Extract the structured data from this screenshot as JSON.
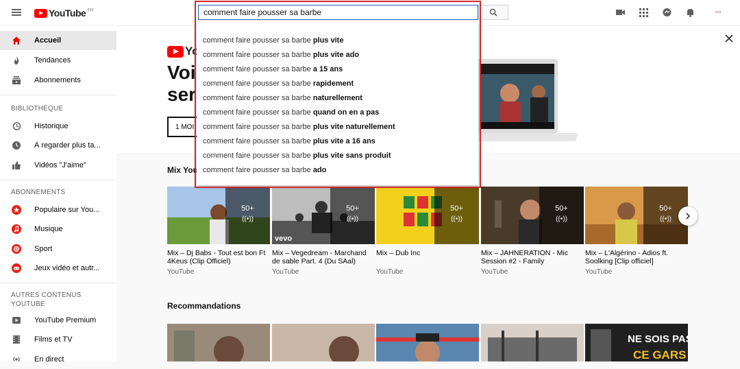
{
  "header": {
    "logo_text": "YouTube",
    "region": "FR",
    "search_value": "comment faire pousser sa barbe",
    "icons": [
      "menu-icon",
      "search-icon",
      "video-camera-icon",
      "apps-grid-icon",
      "messages-icon",
      "bell-icon",
      "account-avatar"
    ]
  },
  "suggestions": [
    {
      "prefix": "comment faire pousser sa barbe ",
      "bold": "plus vite"
    },
    {
      "prefix": "comment faire pousser sa barbe ",
      "bold": "plus vite ado"
    },
    {
      "prefix": "comment faire pousser sa barbe ",
      "bold": "a 15 ans"
    },
    {
      "prefix": "comment faire pousser sa barbe ",
      "bold": "rapidement"
    },
    {
      "prefix": "comment faire pousser sa barbe ",
      "bold": "naturellement"
    },
    {
      "prefix": "comment faire pousser sa barbe ",
      "bold": "quand on en a pas"
    },
    {
      "prefix": "comment faire pousser sa barbe ",
      "bold": "plus vite naturellement"
    },
    {
      "prefix": "comment faire pousser sa barbe ",
      "bold": "plus vite a 16 ans"
    },
    {
      "prefix": "comment faire pousser sa barbe ",
      "bold": "plus vite sans produit"
    },
    {
      "prefix": "comment faire pousser sa barbe ",
      "bold": "ado"
    }
  ],
  "sidebar": {
    "main": [
      {
        "label": "Accueil",
        "icon": "home-icon"
      },
      {
        "label": "Tendances",
        "icon": "flame-icon"
      },
      {
        "label": "Abonnements",
        "icon": "subscriptions-icon"
      }
    ],
    "library_head": "BIBLIOTHÈQUE",
    "library": [
      {
        "label": "Historique",
        "icon": "history-icon"
      },
      {
        "label": "À regarder plus ta...",
        "icon": "clock-icon"
      },
      {
        "label": "Vidéos \"J'aime\"",
        "icon": "thumbs-up-icon"
      }
    ],
    "subs_head": "ABONNEMENTS",
    "subs": [
      {
        "label": "Populaire sur You...",
        "icon": "popular-channel-icon"
      },
      {
        "label": "Musique",
        "icon": "music-channel-icon"
      },
      {
        "label": "Sport",
        "icon": "sport-channel-icon"
      },
      {
        "label": "Jeux vidéo et autr...",
        "icon": "gaming-channel-icon"
      }
    ],
    "other_head_1": "AUTRES CONTENUS",
    "other_head_2": "YOUTUBE",
    "other": [
      {
        "label": "YouTube Premium",
        "icon": "premium-icon"
      },
      {
        "label": "Films et TV",
        "icon": "film-icon"
      },
      {
        "label": "En direct",
        "icon": "live-icon"
      }
    ]
  },
  "banner": {
    "logo_text": "Yo",
    "title": "Voi\nser",
    "button": "1 MOI"
  },
  "mix_section": {
    "title": "Mix You",
    "badge": "50+",
    "cards": [
      {
        "title": "Mix – Dj Babs - Tout est bon Ft 4Keus (Clip Officiel)",
        "channel": "YouTube",
        "color": "#7aa05a"
      },
      {
        "title": "Mix – Vegedream - Marchand de sable Part. 4 (Du SAal)",
        "channel": "YouTube",
        "color": "#8a8a8a",
        "watermark": "vevo"
      },
      {
        "title": "Mix – Dub Inc",
        "channel": "YouTube",
        "color": "#f2d11d"
      },
      {
        "title": "Mix – JAHNERATION - Mic Session #2 - Family",
        "channel": "YouTube",
        "color": "#5a4a3a"
      },
      {
        "title": "Mix – L'Algérino - Adios ft. Soolking [Clip officiel]",
        "channel": "YouTube",
        "color": "#c88a3c"
      }
    ]
  },
  "reco_section": {
    "title": "Recommandations",
    "thumbs": [
      {
        "color": "#9a8a7a"
      },
      {
        "color": "#c9b8a8"
      },
      {
        "color": "#5a87b0"
      },
      {
        "color": "#d8d0c8"
      },
      {
        "color": "#202020",
        "text_1": "NE SOIS PAS",
        "text_2": "CE GARS"
      }
    ]
  }
}
